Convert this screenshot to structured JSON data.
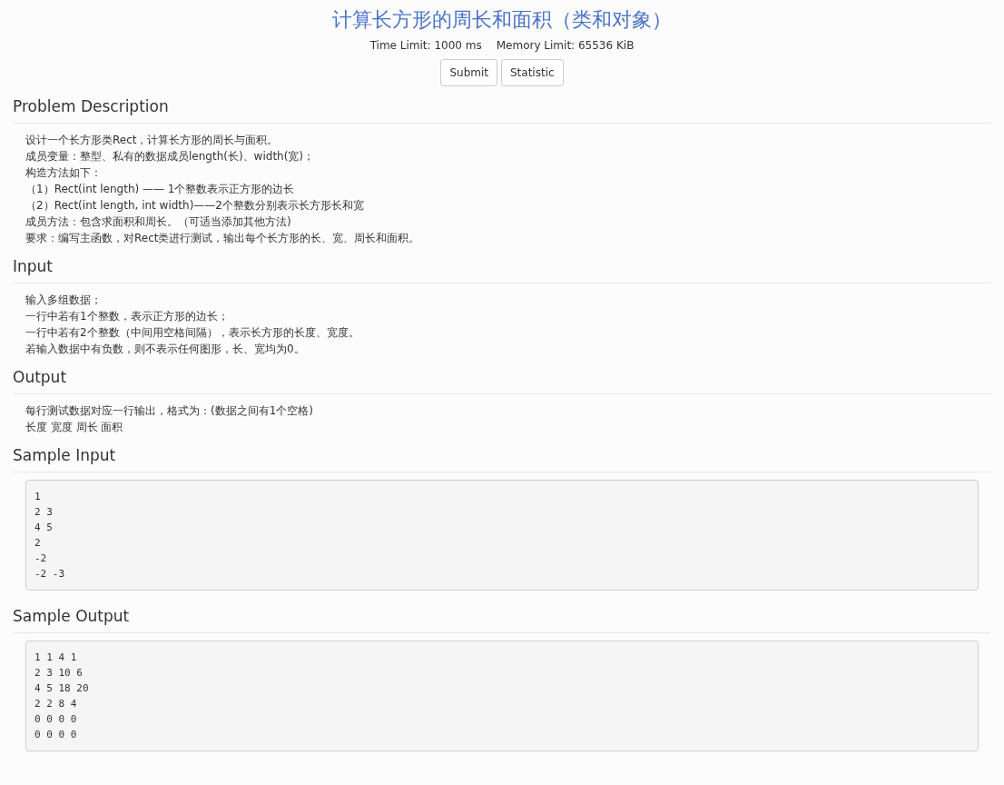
{
  "title": "计算长方形的周长和面积（类和对象）",
  "limits": {
    "time": "Time Limit: 1000 ms",
    "memory": "Memory Limit: 65536 KiB"
  },
  "buttons": [
    "Submit",
    "Statistic"
  ],
  "sections": [
    {
      "kind": "text",
      "heading": "Problem Description",
      "lines": [
        "设计一个长方形类Rect，计算长方形的周长与面积。",
        "成员变量：整型、私有的数据成员length(长)、width(宽)；",
        "构造方法如下：",
        "（1）Rect(int length) —— 1个整数表示正方形的边长",
        "（2）Rect(int length, int width)——2个整数分别表示长方形长和宽",
        "成员方法：包含求面积和周长。（可适当添加其他方法)",
        "要求：编写主函数，对Rect类进行测试，输出每个长方形的长、宽、周长和面积。"
      ]
    },
    {
      "kind": "text",
      "heading": "Input",
      "lines": [
        "输入多组数据；",
        "一行中若有1个整数，表示正方形的边长；",
        "一行中若有2个整数（中间用空格间隔），表示长方形的长度、宽度。",
        "若输入数据中有负数，则不表示任何图形，长、宽均为0。"
      ]
    },
    {
      "kind": "text",
      "heading": "Output",
      "lines": [
        "每行测试数据对应一行输出，格式为：(数据之间有1个空格)",
        "长度 宽度 周长 面积"
      ]
    },
    {
      "kind": "code",
      "heading": "Sample Input",
      "lines": [
        "1",
        "2 3",
        "4 5",
        "2",
        "-2",
        "-2 -3"
      ]
    },
    {
      "kind": "code",
      "heading": "Sample Output",
      "lines": [
        "1 1 4 1",
        "2 3 10 6",
        "4 5 18 20",
        "2 2 8 4",
        "0 0 0 0",
        "0 0 0 0"
      ]
    }
  ]
}
